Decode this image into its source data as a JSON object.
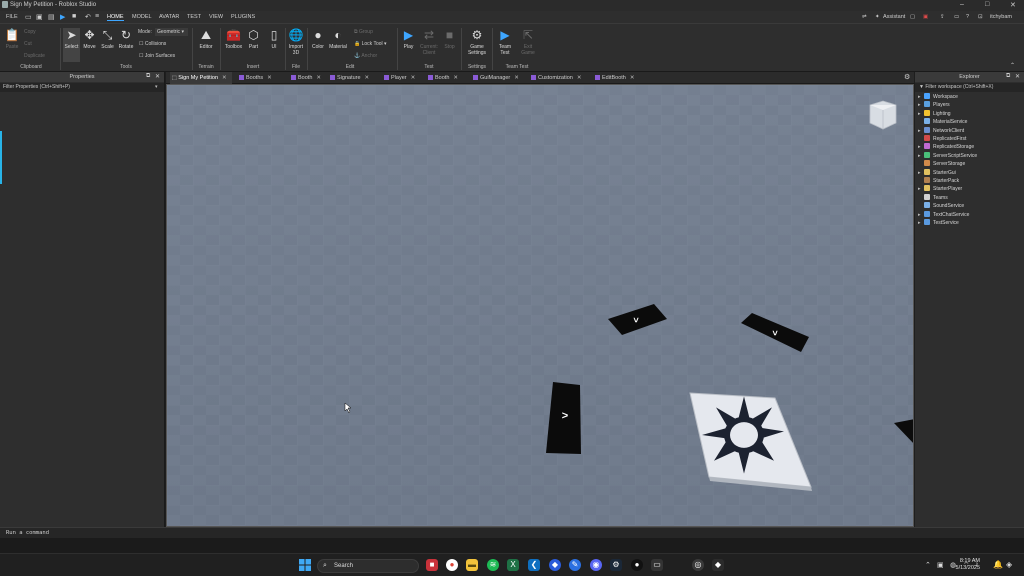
{
  "window": {
    "title": "Sign My Petition - Roblox Studio"
  },
  "menubar": {
    "items": [
      "FILE",
      "HOME",
      "MODEL",
      "AVATAR",
      "TEST",
      "VIEW",
      "PLUGINS"
    ],
    "active": "HOME",
    "assistant": "Assistant",
    "user": "itchybam"
  },
  "ribbon": {
    "clipboard": {
      "paste": "Paste",
      "copy": "Copy",
      "cut": "Cut",
      "duplicate": "Duplicate",
      "group": "Clipboard"
    },
    "tools": {
      "select": "Select",
      "move": "Move",
      "scale": "Scale",
      "rotate": "Rotate",
      "mode_label": "Mode:",
      "mode_value": "Geometric",
      "collisions": "Collisions",
      "join_surfaces": "Join Surfaces",
      "group": "Tools"
    },
    "terrain": {
      "editor": "Editor",
      "group": "Terrain"
    },
    "insert": {
      "toolbox": "Toolbox",
      "part": "Part",
      "ui": "UI",
      "group": "Insert"
    },
    "file": {
      "import": "Import 3D",
      "group": "File"
    },
    "edit": {
      "color": "Color",
      "material": "Material",
      "group_btn": "Group",
      "lock_tool": "Lock Tool",
      "anchor": "Anchor",
      "group": "Edit"
    },
    "test": {
      "play": "Play",
      "current_client": "Current: Client",
      "stop": "Stop",
      "group": "Test"
    },
    "settings": {
      "game_settings": "Game Settings",
      "group": "Settings"
    },
    "team_test": {
      "team_test": "Team Test",
      "exit_game": "Exit Game",
      "group": "Team Test"
    }
  },
  "properties": {
    "title": "Properties",
    "filter": "Filter Properties (Ctrl+Shift+P)"
  },
  "tabs": [
    "Sign My Petition",
    "Booths",
    "Booth",
    "Signature",
    "Player",
    "Booth",
    "GuiManager",
    "Customization",
    "EditBooth"
  ],
  "explorer": {
    "title": "Explorer",
    "filter": "Filter workspace (Ctrl+Shift+X)",
    "items": [
      {
        "label": "Workspace",
        "color": "#4aa3ff",
        "expandable": true
      },
      {
        "label": "Players",
        "color": "#5aa0e0",
        "expandable": true
      },
      {
        "label": "Lighting",
        "color": "#f2c230",
        "expandable": true
      },
      {
        "label": "MaterialService",
        "color": "#7ab0e8",
        "expandable": false
      },
      {
        "label": "NetworkClient",
        "color": "#6a8fd0",
        "expandable": true
      },
      {
        "label": "ReplicatedFirst",
        "color": "#d04a4a",
        "expandable": false
      },
      {
        "label": "ReplicatedStorage",
        "color": "#c06ad0",
        "expandable": true
      },
      {
        "label": "ServerScriptService",
        "color": "#4ac07a",
        "expandable": true
      },
      {
        "label": "ServerStorage",
        "color": "#d08a4a",
        "expandable": false
      },
      {
        "label": "StarterGui",
        "color": "#e0c060",
        "expandable": true
      },
      {
        "label": "StarterPack",
        "color": "#b08050",
        "expandable": false
      },
      {
        "label": "StarterPlayer",
        "color": "#e0c060",
        "expandable": true
      },
      {
        "label": "Teams",
        "color": "#d0d0d0",
        "expandable": false
      },
      {
        "label": "SoundService",
        "color": "#7ab0e8",
        "expandable": false
      },
      {
        "label": "TextChatService",
        "color": "#5a9ae0",
        "expandable": true
      },
      {
        "label": "TestService",
        "color": "#5a9ae0",
        "expandable": true
      }
    ]
  },
  "command_bar": {
    "placeholder": "Run a command"
  },
  "taskbar": {
    "search": "Search",
    "time": "8:19 AM",
    "date": "5/13/2025"
  },
  "viewport": {
    "arrow_glyph": ">"
  }
}
